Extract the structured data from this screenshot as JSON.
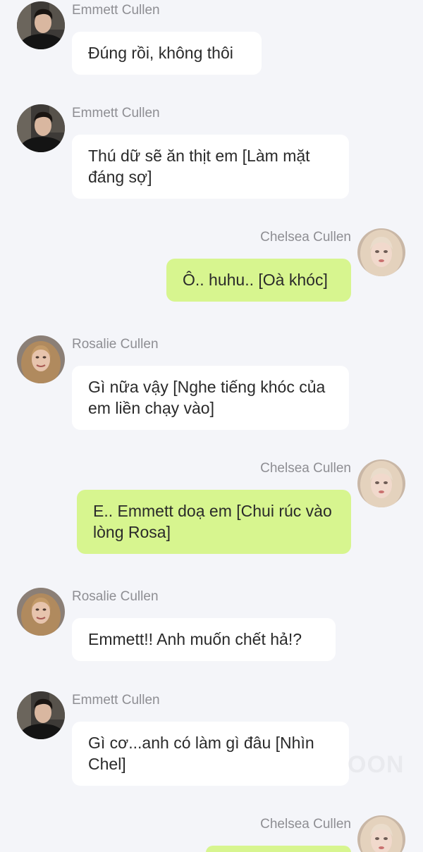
{
  "conversation": {
    "messages": [
      {
        "sender": "Emmett Cullen",
        "avatar": "emmett-avatar",
        "side": "left",
        "text": "Đúng rồi, không thôi"
      },
      {
        "sender": "Emmett Cullen",
        "avatar": "emmett-avatar",
        "side": "left",
        "text": "Thú dữ sẽ ăn thịt em [Làm mặt đáng sợ]"
      },
      {
        "sender": "Chelsea Cullen",
        "avatar": "chelsea-avatar",
        "side": "right",
        "text": "Ô.. huhu.. [Oà khóc]"
      },
      {
        "sender": "Rosalie Cullen",
        "avatar": "rosalie-avatar",
        "side": "left",
        "text": "Gì nữa vậy [Nghe tiếng khóc của em liền chạy vào]"
      },
      {
        "sender": "Chelsea Cullen",
        "avatar": "chelsea-avatar",
        "side": "right",
        "text": "E.. Emmett doạ em [Chui rúc vào lòng Rosa]"
      },
      {
        "sender": "Rosalie Cullen",
        "avatar": "rosalie-avatar",
        "side": "left",
        "text": "Emmett!! Anh muốn chết hả!?"
      },
      {
        "sender": "Emmett Cullen",
        "avatar": "emmett-avatar",
        "side": "left",
        "text": "Gì cơ...anh có làm gì đâu [Nhìn Chel]"
      },
      {
        "sender": "Chelsea Cullen",
        "avatar": "chelsea-avatar",
        "side": "right",
        "text": ""
      }
    ]
  },
  "watermark": {
    "text": "OON"
  },
  "colors": {
    "background": "#f4f5f9",
    "incoming_bubble": "#ffffff",
    "outgoing_bubble": "#d7f58f",
    "sender_name": "#8e8e93",
    "message_text": "#2a2a2a"
  }
}
